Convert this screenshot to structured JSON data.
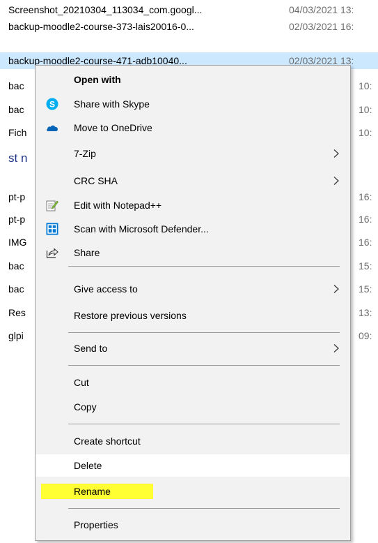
{
  "files": [
    {
      "name": "Screenshot_20210304_113034_com.googl...",
      "date": "04/03/2021 13:"
    },
    {
      "name": "backup-moodle2-course-373-lais20016-0...",
      "date": "02/03/2021 16:"
    },
    {
      "name": "backup-moodle2-course-471-adb10040...",
      "date": "02/03/2021 13:"
    },
    {
      "name": "bac",
      "date": "10:"
    },
    {
      "name": "bac",
      "date": "10:"
    },
    {
      "name": "Fich",
      "date": "10:"
    }
  ],
  "group_header": "st n",
  "files2": [
    {
      "name": "pt-p",
      "date": "16:"
    },
    {
      "name": "pt-p",
      "date": "16:"
    },
    {
      "name": "IMG",
      "date": "16:"
    },
    {
      "name": "bac",
      "date": "15:"
    },
    {
      "name": "bac",
      "date": "15:"
    },
    {
      "name": "Res",
      "date": "13:"
    },
    {
      "name": "glpi",
      "date": "09:"
    }
  ],
  "menu": {
    "open_with": "Open with",
    "share_skype": "Share with Skype",
    "move_onedrive": "Move to OneDrive",
    "seven_zip": "7-Zip",
    "crc_sha": "CRC SHA",
    "edit_notepad": "Edit with Notepad++",
    "scan_defender": "Scan with Microsoft Defender...",
    "share": "Share",
    "give_access": "Give access to",
    "restore_versions": "Restore previous versions",
    "send_to": "Send to",
    "cut": "Cut",
    "copy": "Copy",
    "create_shortcut": "Create shortcut",
    "delete": "Delete",
    "rename": "Rename",
    "properties": "Properties"
  },
  "colors": {
    "selection": "#cce8ff",
    "menu_bg": "#f2f2f2",
    "rename_highlight": "#ffff33",
    "skype": "#00aff0",
    "onedrive": "#0364b8",
    "defender": "#0078d4"
  }
}
